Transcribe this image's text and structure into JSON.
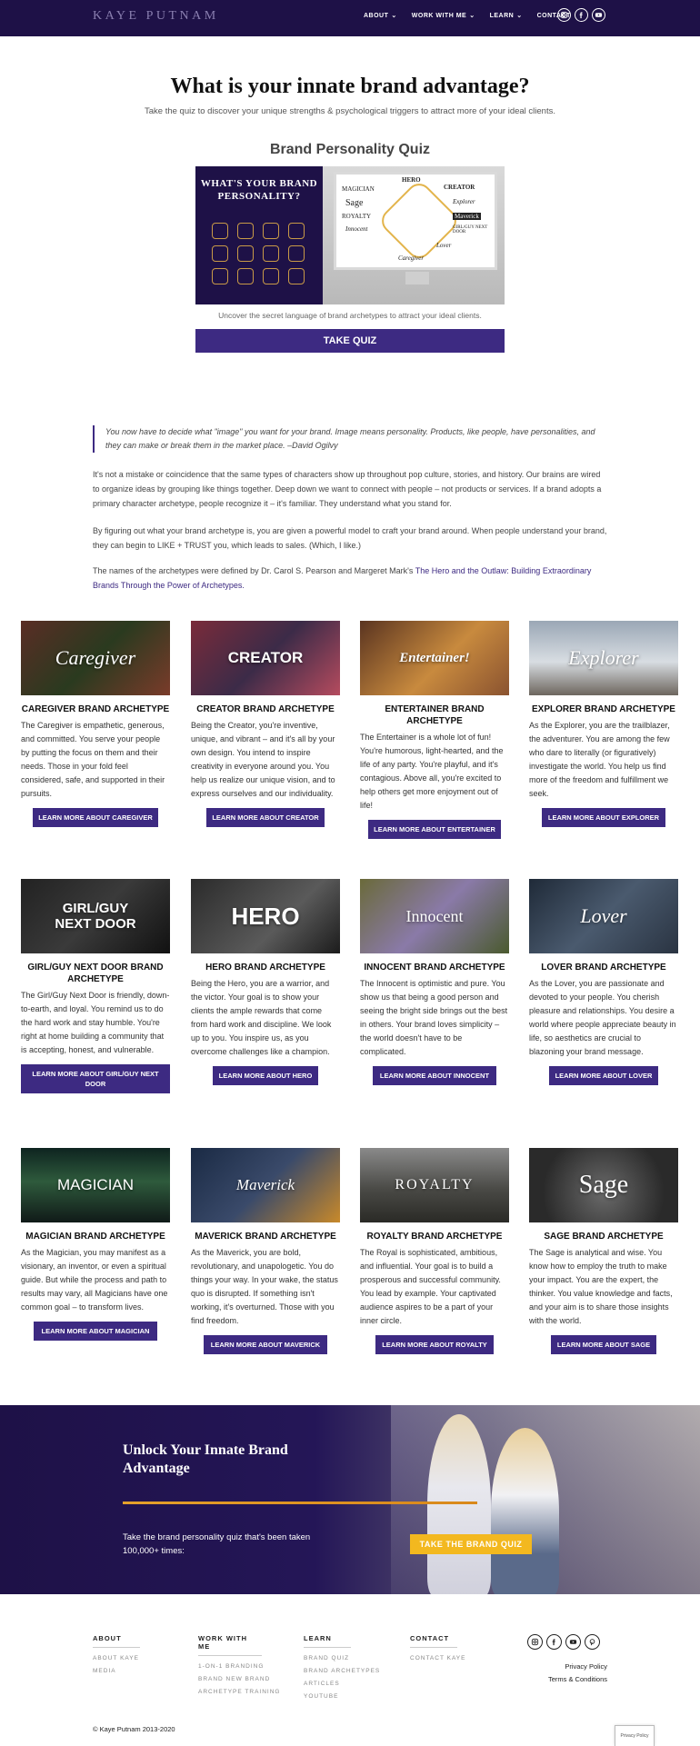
{
  "header": {
    "logo": "KAYE PUTNAM",
    "nav": [
      {
        "label": "ABOUT",
        "dropdown": true
      },
      {
        "label": "WORK WITH ME",
        "dropdown": true
      },
      {
        "label": "LEARN",
        "dropdown": true
      },
      {
        "label": "CONTACT",
        "dropdown": false
      }
    ],
    "social": [
      "instagram-icon",
      "facebook-icon",
      "youtube-icon"
    ]
  },
  "hero": {
    "title": "What is your innate brand advantage?",
    "subtitle": "Take the quiz to discover your unique strengths & psychological triggers to attract more of your ideal clients.",
    "quiz_title": "Brand Personality Quiz",
    "quiz_image_heading": "WHAT'S YOUR BRAND PERSONALITY?",
    "monitor_words": [
      "HERO",
      "MAGICIAN",
      "CREATOR",
      "Sage",
      "Explorer",
      "ROYALTY",
      "Maverick",
      "Innocent",
      "GIRL/GUY NEXT DOOR",
      "Lover",
      "Caregiver"
    ],
    "caption": "Uncover the secret language of brand archetypes to attract your ideal clients.",
    "button": "TAKE QUIZ"
  },
  "intro": {
    "quote": "You now have to decide what \"image\" you want for your brand. Image means personality. Products, like people, have personalities, and they can make or break them in the market place. –David Ogilvy",
    "p1": "It's not a mistake or coincidence that the same types of characters show up throughout pop culture, stories, and history. Our brains are wired to organize ideas by grouping like things together. Deep down we want to connect with people – not products or services. If a brand adopts a primary character archetype, people recognize it – it's familiar. They understand what you stand for.",
    "p2": "By figuring out what your brand archetype is, you are given a powerful model to craft your brand around. When people understand your brand, they can begin to LIKE + TRUST you, which leads to sales. (Which, I like.)",
    "p3_text": "The names of the archetypes were defined by Dr. Carol S. Pearson and Margeret Mark's ",
    "p3_link": "The Hero and the Outlaw: Building Extraordinary Brands Through the Power of Archetypes."
  },
  "archetypes": [
    {
      "image_text": "Caregiver",
      "title": "CAREGIVER BRAND ARCHETYPE",
      "body": "The Caregiver is empathetic, generous, and committed. You serve your people by putting the focus on them and their needs. Those in your fold feel considered, safe, and supported in their pursuits.",
      "button": "LEARN MORE ABOUT CAREGIVER"
    },
    {
      "image_text": "CREATOR",
      "title": "CREATOR BRAND ARCHETYPE",
      "body": "Being the Creator, you're inventive, unique, and vibrant – and it's all by your own design. You intend to inspire creativity in everyone around you. You help us realize our unique vision, and to express ourselves and our individuality.",
      "button": "LEARN MORE ABOUT CREATOR"
    },
    {
      "image_text": "Entertainer!",
      "title": "ENTERTAINER BRAND ARCHETYPE",
      "body": "The Entertainer is a whole lot of fun! You're humorous, light-hearted, and the life of any party. You're playful, and it's contagious. Above all, you're excited to help others get more enjoyment out of life!",
      "button": "LEARN MORE ABOUT ENTERTAINER"
    },
    {
      "image_text": "Explorer",
      "title": "EXPLORER BRAND ARCHETYPE",
      "body": "As the Explorer, you are the trailblazer, the adventurer. You are among the few who dare to literally (or figuratively) investigate the world. You help us find more of the freedom and fulfillment we seek.",
      "button": "LEARN MORE ABOUT EXPLORER"
    },
    {
      "image_text": "GIRL/GUY NEXT DOOR",
      "title": "GIRL/GUY NEXT DOOR BRAND ARCHETYPE",
      "body": "The Girl/Guy Next Door is friendly, down-to-earth, and loyal. You remind us to do the hard work and stay humble. You're right at home building a community that is accepting, honest, and vulnerable.",
      "button": "LEARN MORE ABOUT GIRL/GUY NEXT DOOR"
    },
    {
      "image_text": "HERO",
      "title": "HERO BRAND ARCHETYPE",
      "body": "Being the Hero, you are a warrior, and the victor. Your goal is to show your clients the ample rewards that come from hard work and discipline. We look up to you. You inspire us, as you overcome challenges like a champion.",
      "button": "LEARN MORE ABOUT HERO"
    },
    {
      "image_text": "Innocent",
      "title": "INNOCENT BRAND ARCHETYPE",
      "body": "The Innocent is optimistic and pure. You show us that being a good person and seeing the bright side brings out the best in others. Your brand loves simplicity – the world doesn't have to be complicated.",
      "button": "LEARN MORE ABOUT INNOCENT"
    },
    {
      "image_text": "Lover",
      "title": "LOVER BRAND ARCHETYPE",
      "body": "As the Lover, you are passionate and devoted to your people. You cherish pleasure and relationships. You desire a world where people appreciate beauty in life, so aesthetics are crucial to blazoning your brand message.",
      "button": "LEARN MORE ABOUT LOVER"
    },
    {
      "image_text": "MAGICIAN",
      "title": "MAGICIAN BRAND ARCHETYPE",
      "body": "As the Magician, you may manifest as a visionary, an inventor, or even a spiritual guide. But while the process and path to results may vary, all Magicians have one common goal – to transform lives.",
      "button": "LEARN MORE ABOUT MAGICIAN"
    },
    {
      "image_text": "Maverick",
      "title": "MAVERICK BRAND ARCHETYPE",
      "body": "As the Maverick, you are bold, revolutionary, and unapologetic. You do things your way. In your wake, the status quo is disrupted. If something isn't working, it's overturned. Those with you find freedom.",
      "button": "LEARN MORE ABOUT MAVERICK"
    },
    {
      "image_text": "ROYALTY",
      "title": "ROYALTY BRAND ARCHETYPE",
      "body": "The Royal is sophisticated, ambitious, and influential. Your goal is to build a prosperous and successful community. You lead by example. Your captivated audience aspires to be a part of your inner circle.",
      "button": "LEARN MORE ABOUT ROYALTY"
    },
    {
      "image_text": "Sage",
      "title": "SAGE BRAND ARCHETYPE",
      "body": "The Sage is analytical and wise. You know how to employ the truth to make your impact. You are the expert, the thinker. You value knowledge and facts, and your aim is to share those insights with the world.",
      "button": "LEARN MORE ABOUT SAGE"
    }
  ],
  "cta": {
    "title": "Unlock Your Innate Brand Advantage",
    "text": "Take the brand personality quiz that's been taken 100,000+ times:",
    "button": "TAKE THE BRAND QUIZ"
  },
  "footer": {
    "columns": [
      {
        "heading": "ABOUT",
        "links": [
          "ABOUT KAYE",
          "MEDIA"
        ]
      },
      {
        "heading": "WORK WITH ME",
        "links": [
          "1-ON-1 BRANDING",
          "BRAND NEW BRAND",
          "ARCHETYPE TRAINING"
        ]
      },
      {
        "heading": "LEARN",
        "links": [
          "BRAND QUIZ",
          "BRAND ARCHETYPES",
          "ARTICLES",
          "YOUTUBE"
        ]
      },
      {
        "heading": "CONTACT",
        "links": [
          "CONTACT KAYE"
        ]
      }
    ],
    "social": [
      "instagram-icon",
      "facebook-icon",
      "youtube-icon",
      "pinterest-icon"
    ],
    "privacy": "Privacy Policy",
    "terms": "Terms & Conditions",
    "copyright": "© Kaye Putnam 2013-2020",
    "privacy_badge": "Privacy Policy"
  },
  "colors": {
    "brand_navy": "#1e1147",
    "button_purple": "#3d2a82",
    "cta_yellow": "#f3b81f",
    "accent_gold": "#e4a12b"
  }
}
